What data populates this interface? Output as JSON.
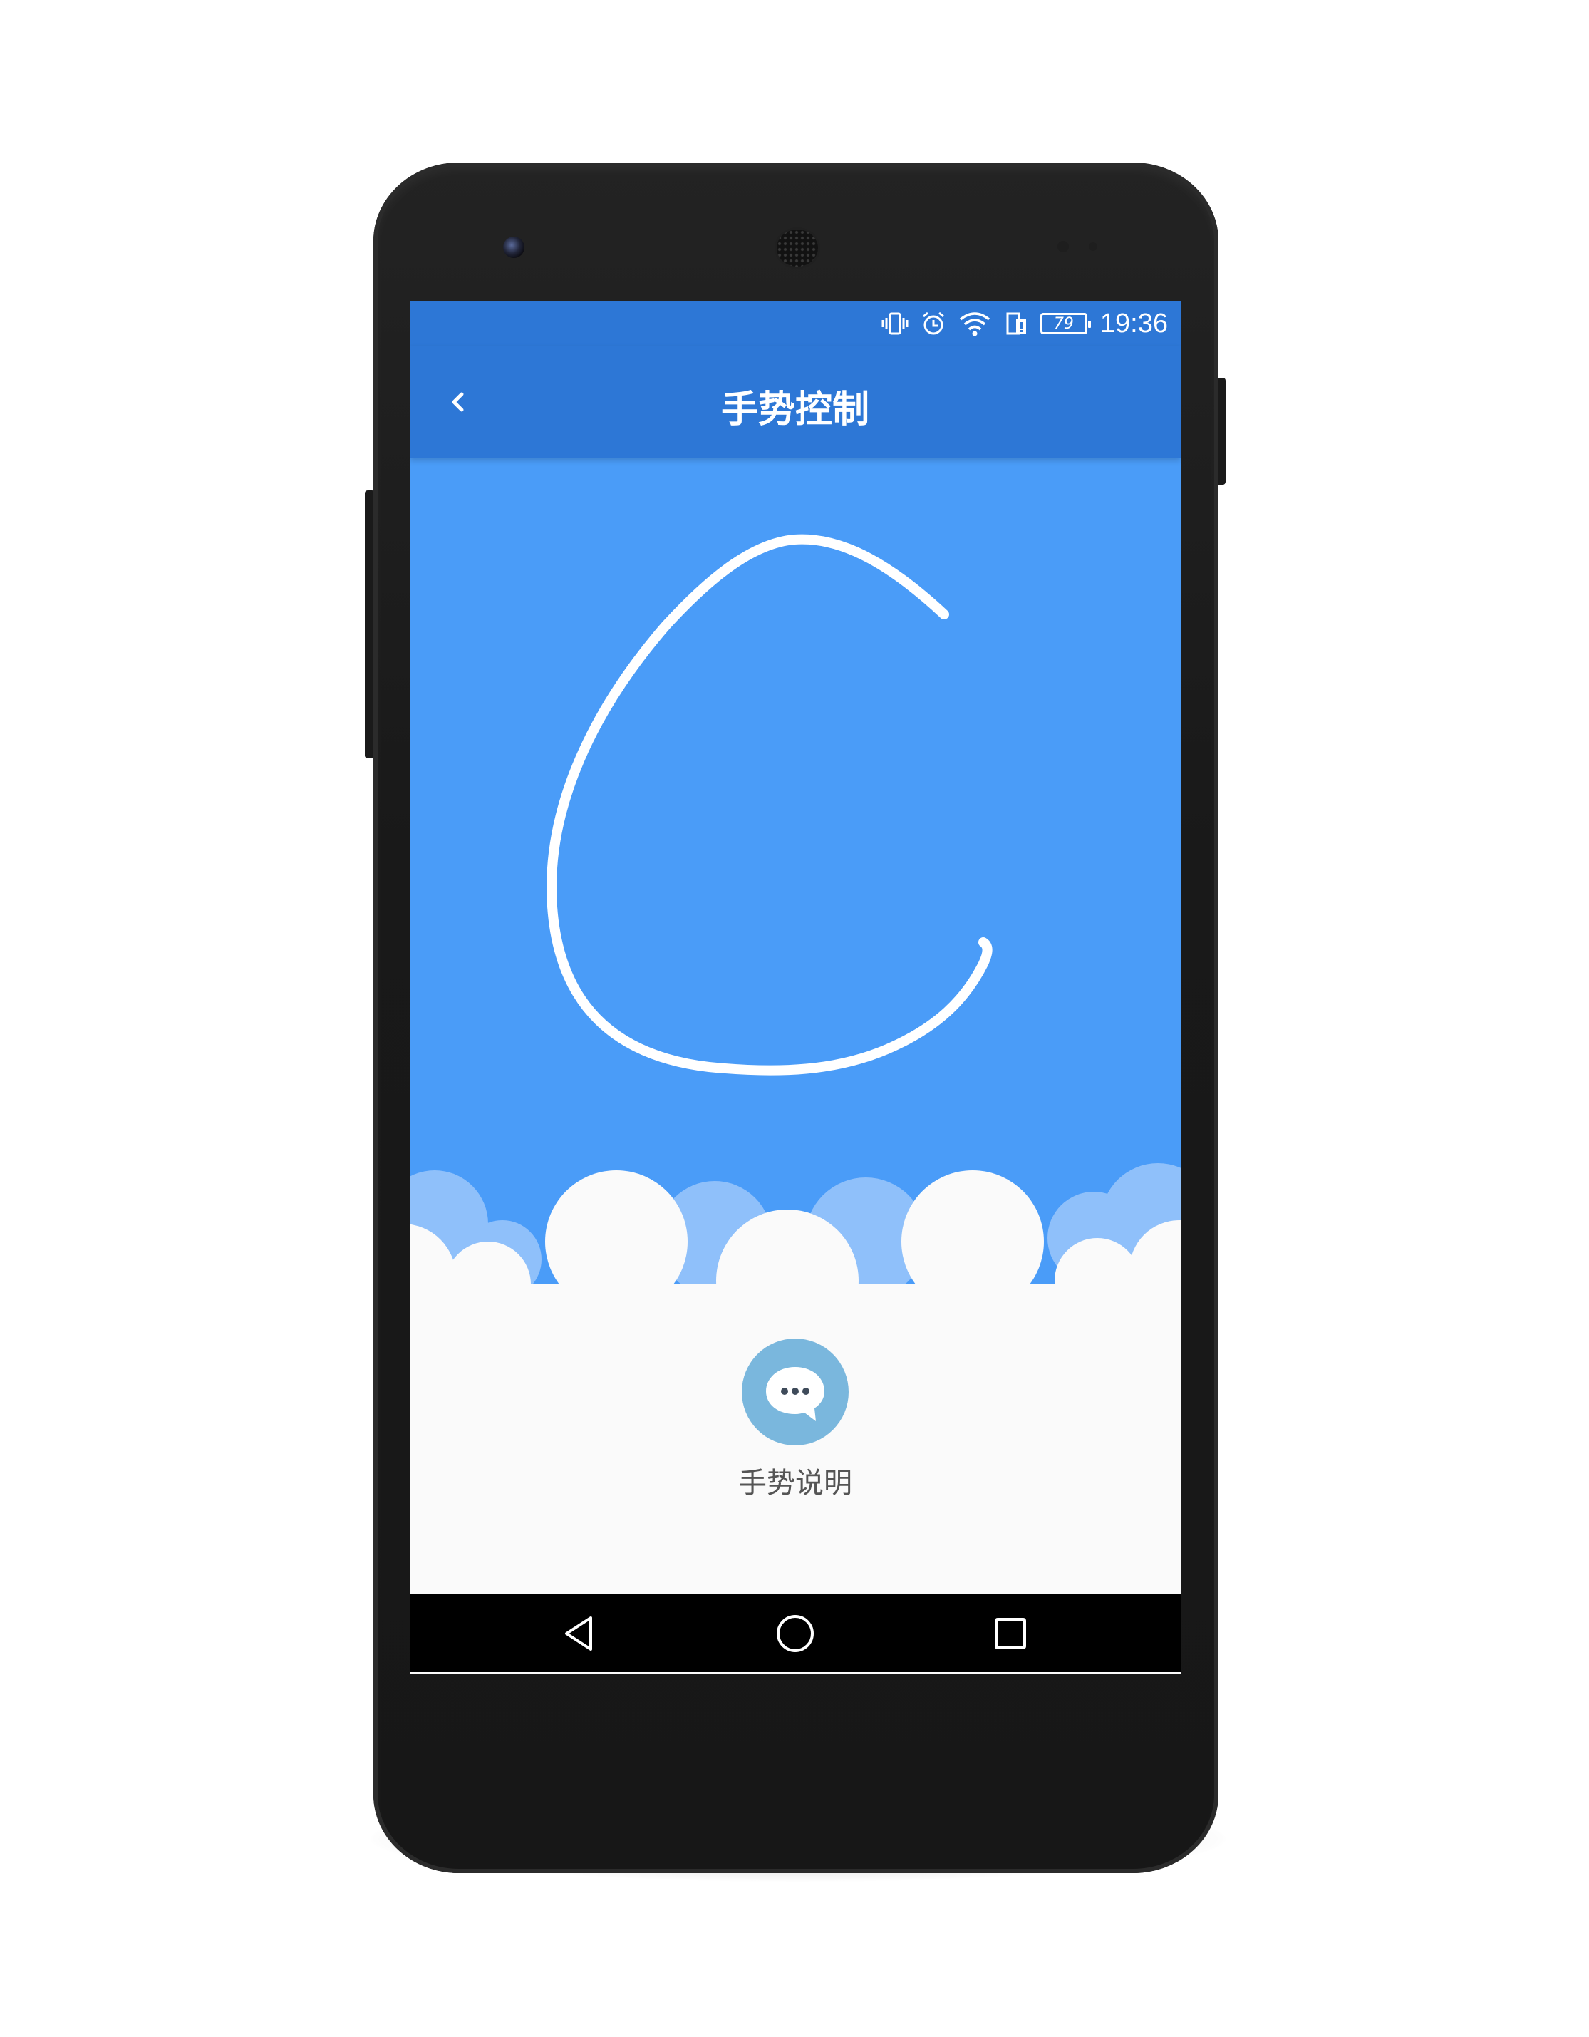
{
  "status_bar": {
    "time": "19:36",
    "battery_level": "79",
    "icons": [
      "vibrate-icon",
      "alarm-icon",
      "wifi-icon",
      "sim-icon",
      "battery-icon"
    ]
  },
  "app_bar": {
    "title": "手势控制",
    "back_icon": "chevron-left-icon"
  },
  "gesture": {
    "shape": "C",
    "stroke_color": "#ffffff",
    "background_color": "#4a9cf8"
  },
  "help": {
    "label": "手势说明",
    "icon": "chat-bubble-icon",
    "icon_bg_color": "#7ab7dd"
  },
  "nav_bar": {
    "icons": [
      "back-triangle-icon",
      "home-circle-icon",
      "recents-square-icon"
    ]
  },
  "colors": {
    "primary": "#2d77d6",
    "accent": "#4a9cf8",
    "cloud_light": "#8fc0fa",
    "surface": "#fafafa"
  }
}
